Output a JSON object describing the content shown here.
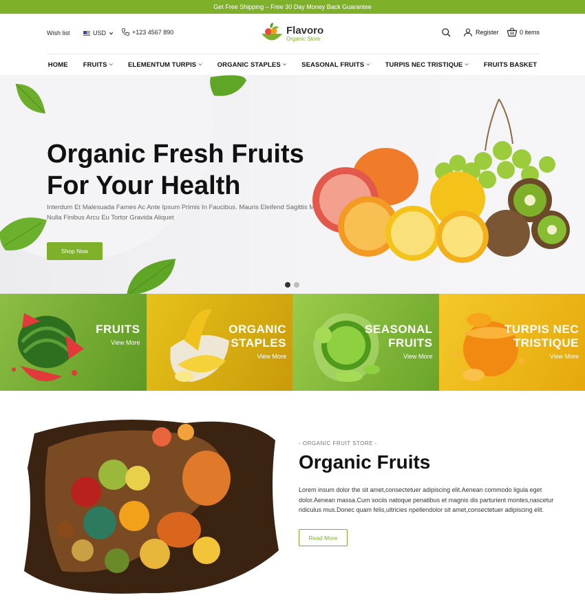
{
  "topbar": {
    "text": "Get Free Shipping – Free 30 Day Money Back Guarantee"
  },
  "header": {
    "wishlist": "Wish list",
    "currency": "USD",
    "phone": "+123 4567 890",
    "logo_name": "Flavoro",
    "logo_sub": "Organic Store",
    "register": "Register",
    "cart": "0 items"
  },
  "nav": {
    "items": [
      {
        "label": "HOME"
      },
      {
        "label": "FRUITS"
      },
      {
        "label": "ELEMENTUM TURPIS"
      },
      {
        "label": "ORGANIC STAPLES"
      },
      {
        "label": "SEASONAL FRUITS"
      },
      {
        "label": "TURPIS NEC TRISTIQUE"
      },
      {
        "label": "FRUITS BASKET"
      }
    ]
  },
  "hero": {
    "title_line1": "Organic Fresh Fruits",
    "title_line2": "For Your Health",
    "text_line1": "Interdum Et Malesuada Fames Ac Ante Ipsum Primis In Faucibus. Mauris Eleifend Sagittis Molli",
    "text_line2": "Nulla Finibus Arcu Eu Tortor Gravida Aliquet",
    "button": "Shop Now"
  },
  "tiles": [
    {
      "line1": "FRUITS",
      "line2": "",
      "link": "View More"
    },
    {
      "line1": "ORGANIC",
      "line2": "STAPLES",
      "link": "View More"
    },
    {
      "line1": "SEASONAL",
      "line2": "FRUITS",
      "link": "View More"
    },
    {
      "line1": "TURPIS NEC",
      "line2": "TRISTIQUE",
      "link": "View More"
    }
  ],
  "about": {
    "kicker": "- ORGANIC FRUIT STORE -",
    "title": "Organic Fruits",
    "text": "Lorem insum dolor the sit amet,consectetuer adipiscing elit.Aenean commodo ligula eget dolor.Aenean massa.Cum sociis natoque penatibus et magnis dis parturient montes,nascetur ridiculus mus.Donec quam felis,ultricies npellendolor sit amet,consectetuer adipiscing elit.",
    "button": "Read More"
  },
  "colors": {
    "accent": "#7fb02a"
  }
}
